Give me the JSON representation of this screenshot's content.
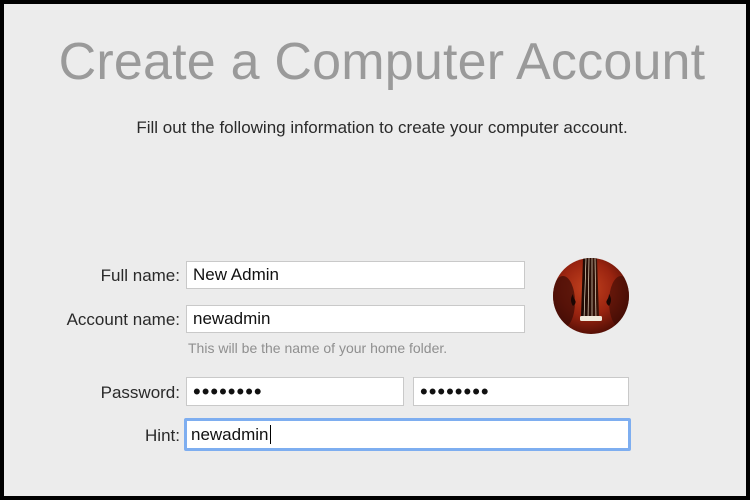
{
  "header": {
    "title": "Create a Computer Account",
    "subtitle": "Fill out the following information to create your computer account."
  },
  "form": {
    "full_name": {
      "label": "Full name:",
      "value": "New Admin"
    },
    "account_name": {
      "label": "Account name:",
      "value": "newadmin",
      "note": "This will be the name of your home folder."
    },
    "password": {
      "label": "Password:",
      "value": "••••••••",
      "verify_value": "••••••••"
    },
    "hint": {
      "label": "Hint:",
      "value": "newadmin"
    }
  },
  "avatar": {
    "icon": "violin-icon"
  },
  "colors": {
    "focus_ring": "#7eaef0",
    "background": "#ececec",
    "title": "#9a9a9a"
  }
}
